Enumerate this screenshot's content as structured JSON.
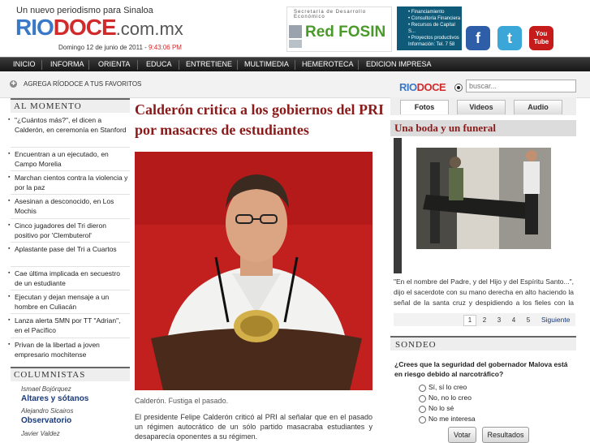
{
  "header": {
    "tagline": "Un nuevo periodismo para Sinaloa",
    "logo_rio": "RIO",
    "logo_doce": "DOCE",
    "logo_domain": ".com.mx",
    "date": "Domingo 12 de junio de 2011 - ",
    "time": "9:43:06 PM",
    "ad_fosin_small": "Secretaría de Desarrollo Económico",
    "ad_fosin": "Red FOSIN",
    "ad_financing_lines": [
      "• Financiamiento",
      "• Consultoría Financiera",
      "• Recursos de Capital S...",
      "• Proyectos productivos",
      "Información: Tel. 7 58"
    ],
    "social": [
      "f",
      "t",
      "You Tube"
    ]
  },
  "nav": [
    "INICIO",
    "INFORMA",
    "ORIENTA",
    "EDUCA",
    "ENTRETIENE",
    "MULTIMEDIA",
    "HEMEROTECA",
    "EDICION IMPRESA"
  ],
  "subbar": {
    "favorites": "AGREGA RÍODOCE A TUS FAVORITOS",
    "search_logo_rio": "RIO",
    "search_logo_doce": "DOCE",
    "search_placeholder": "buscar..."
  },
  "al_momento": {
    "title": "AL MOMENTO",
    "items": [
      "\"¿Cuántos más?\", el dicen a Calderón, en ceremonía en Stanford",
      "Encuentran a un ejecutado, en Campo Morelia",
      "Marchan cientos contra la violencia y por la paz",
      "Asesinan a desconocido, en Los Mochis",
      "Cinco jugadores del Tri dieron positivo por 'Clembuterol'",
      "Aplastante pase del Tri a Cuartos",
      "Cae última implicada en secuestro de un estudiante",
      "Ejecutan y dejan mensaje a un hombre en Culiacán",
      "Lanza alerta SMN por TT \"Adrian\", en el Pacífico",
      "Privan de la libertad a joven empresario mochitense"
    ]
  },
  "columnistas": {
    "title": "COLUMNISTAS",
    "items": [
      {
        "name": "Ismael Bojórquez",
        "column": "Altares y sótanos"
      },
      {
        "name": "Alejandro Sicairos",
        "column": "Observatorio"
      },
      {
        "name": "Javier Valdez",
        "column": ""
      }
    ]
  },
  "article": {
    "headline": "Calderón critica a los gobiernos del PRI por masacres de estudiantes",
    "caption": "Calderón. Fustiga el pasado.",
    "body": "El presidente Felipe Calderón criticó al PRI al señalar que en el pasado un régimen autocrático de un sólo partido masacraba estudiantes y desaparecía oponentes a su régimen."
  },
  "media_tabs": [
    "Fotos",
    "Videos",
    "Audio"
  ],
  "gallery": {
    "title": "Una boda y un funeral",
    "text": "\"En el nombre del Padre, y del Hijo y del Espíritu Santo...\", dijo el sacerdote con su mano derecha en alto haciendo la señal de la santa cruz y despidiendo a los fieles con la bendición divina; y el agente de la",
    "pages": [
      "1",
      "2",
      "3",
      "4",
      "5"
    ],
    "next": "Siguiente"
  },
  "sondeo": {
    "title": "SONDEO",
    "question": "¿Crees que la seguridad del gobernador Malova está en riesgo debido al narcotráfico?",
    "options": [
      "Sí, sí lo creo",
      "No, no lo creo",
      "No lo sé",
      "No me interesa"
    ],
    "vote": "Votar",
    "results": "Resultados"
  },
  "colors": {
    "accent_red": "#8b1a1a",
    "logo_blue": "#3a78c8",
    "logo_red": "#d22a2a",
    "nav_bg": "#1e1e1e"
  }
}
